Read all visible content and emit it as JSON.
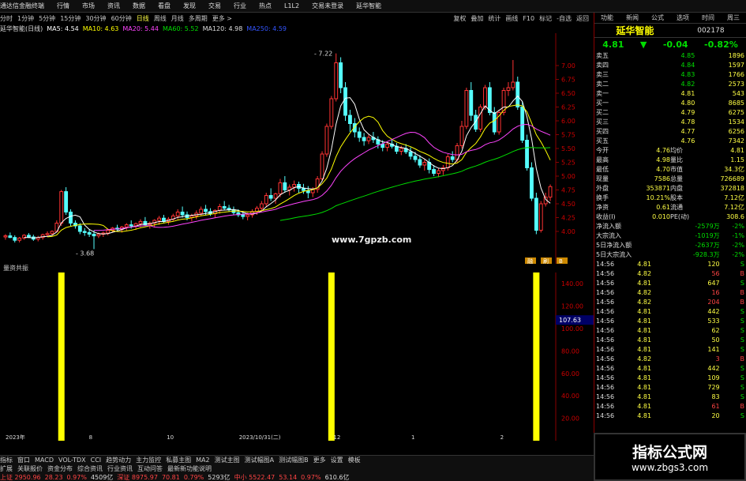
{
  "app": {
    "title": "通达信金融终端",
    "menu": [
      "行情",
      "市场",
      "资讯",
      "数据",
      "看盘",
      "发现",
      "交易",
      "行业",
      "热点",
      "L1L2"
    ],
    "notice": "交易未登录",
    "notice2": "延华智能",
    "right_menu": [
      "功能",
      "新闻",
      "公式",
      "选项",
      "时间",
      "周三",
      "",
      "口",
      "X"
    ]
  },
  "toolbar": {
    "periods": [
      "分时",
      "1分钟",
      "5分钟",
      "15分钟",
      "30分钟",
      "60分钟",
      "日线",
      "周线",
      "月线",
      "多周期",
      "更多 >"
    ],
    "right": [
      "复权",
      "叠加",
      "统计",
      "画线",
      "F10",
      "标记",
      "-自选",
      "返回"
    ]
  },
  "chart_info": {
    "name": "延华智能(日线)",
    "ma": [
      {
        "label": "MA5: 4.54",
        "color": "#ffffff"
      },
      {
        "label": "MA10: 4.63",
        "color": "#ffff00"
      },
      {
        "label": "MA20: 5.44",
        "color": "#ff44ff"
      },
      {
        "label": "MA60: 5.52",
        "color": "#00dd00"
      },
      {
        "label": "MA120: 4.98",
        "color": "#dddddd"
      },
      {
        "label": "MA250: 4.59",
        "color": "#3355ff"
      }
    ]
  },
  "chart_data": {
    "type": "candlestick",
    "ylim": [
      3.5,
      7.5
    ],
    "ticks": [
      "7.00",
      "6.75",
      "6.50",
      "6.25",
      "6.00",
      "5.75",
      "5.50",
      "5.25",
      "5.00",
      "4.75",
      "4.50",
      "4.25",
      "4.00"
    ],
    "candles": [
      [
        3.9,
        3.95,
        3.85,
        3.92
      ],
      [
        3.92,
        3.98,
        3.88,
        3.89
      ],
      [
        3.89,
        3.93,
        3.8,
        3.84
      ],
      [
        3.84,
        3.9,
        3.8,
        3.88
      ],
      [
        3.88,
        3.95,
        3.85,
        3.93
      ],
      [
        3.93,
        3.97,
        3.88,
        3.9
      ],
      [
        3.9,
        3.94,
        3.83,
        3.86
      ],
      [
        3.86,
        3.92,
        3.82,
        3.89
      ],
      [
        3.89,
        3.96,
        3.85,
        3.94
      ],
      [
        3.94,
        4.0,
        3.9,
        3.96
      ],
      [
        3.96,
        4.02,
        3.92,
        4.0
      ],
      [
        4.0,
        4.2,
        3.98,
        4.15
      ],
      [
        4.15,
        4.75,
        4.1,
        4.72
      ],
      [
        4.72,
        4.8,
        4.3,
        4.35
      ],
      [
        4.35,
        4.4,
        4.1,
        4.15
      ],
      [
        4.15,
        4.2,
        4.05,
        4.1
      ],
      [
        4.1,
        4.15,
        3.95,
        4.0
      ],
      [
        4.0,
        4.06,
        3.92,
        3.98
      ],
      [
        3.98,
        4.04,
        3.9,
        3.95
      ],
      [
        3.95,
        4.02,
        3.68,
        3.92
      ],
      [
        3.92,
        3.98,
        3.88,
        3.95
      ],
      [
        3.95,
        4.0,
        3.9,
        3.97
      ],
      [
        3.97,
        4.05,
        3.93,
        4.02
      ],
      [
        4.02,
        4.08,
        3.98,
        4.06
      ],
      [
        4.06,
        4.12,
        4.0,
        4.04
      ],
      [
        4.04,
        4.1,
        3.98,
        4.08
      ],
      [
        4.08,
        4.15,
        4.02,
        4.12
      ],
      [
        4.12,
        4.2,
        4.05,
        4.1
      ],
      [
        4.1,
        4.16,
        4.03,
        4.14
      ],
      [
        4.14,
        4.22,
        4.08,
        4.18
      ],
      [
        4.18,
        4.26,
        4.1,
        4.12
      ],
      [
        4.12,
        4.18,
        4.05,
        4.15
      ],
      [
        4.15,
        4.22,
        4.08,
        4.2
      ],
      [
        4.2,
        4.28,
        4.12,
        4.24
      ],
      [
        4.24,
        4.3,
        4.15,
        4.18
      ],
      [
        4.18,
        4.26,
        4.12,
        4.22
      ],
      [
        4.22,
        4.32,
        4.18,
        4.28
      ],
      [
        4.28,
        4.4,
        4.22,
        4.35
      ],
      [
        4.35,
        4.45,
        4.25,
        4.3
      ],
      [
        4.3,
        4.36,
        4.2,
        4.25
      ],
      [
        4.25,
        4.32,
        4.18,
        4.28
      ],
      [
        4.28,
        4.38,
        4.22,
        4.33
      ],
      [
        4.33,
        4.45,
        4.28,
        4.4
      ],
      [
        4.4,
        4.48,
        4.3,
        4.36
      ],
      [
        4.36,
        4.42,
        4.28,
        4.32
      ],
      [
        4.32,
        4.4,
        4.25,
        4.38
      ],
      [
        4.38,
        4.5,
        4.32,
        4.45
      ],
      [
        4.45,
        4.55,
        4.38,
        4.42
      ],
      [
        4.42,
        4.48,
        4.35,
        4.39
      ],
      [
        4.39,
        4.45,
        4.3,
        4.34
      ],
      [
        4.34,
        4.4,
        4.26,
        4.3
      ],
      [
        4.3,
        4.36,
        4.22,
        4.27
      ],
      [
        4.27,
        4.34,
        4.2,
        4.3
      ],
      [
        4.3,
        4.4,
        4.25,
        4.36
      ],
      [
        4.36,
        4.46,
        4.3,
        4.42
      ],
      [
        4.42,
        4.55,
        4.38,
        4.5
      ],
      [
        4.5,
        4.7,
        4.45,
        4.65
      ],
      [
        4.65,
        4.78,
        4.55,
        4.6
      ],
      [
        4.6,
        4.7,
        4.5,
        4.68
      ],
      [
        4.68,
        4.95,
        4.62,
        4.88
      ],
      [
        4.88,
        5.0,
        4.7,
        4.75
      ],
      [
        4.75,
        4.85,
        4.65,
        4.8
      ],
      [
        4.8,
        4.92,
        4.72,
        4.85
      ],
      [
        4.85,
        4.9,
        4.7,
        4.78
      ],
      [
        4.78,
        4.86,
        4.68,
        4.74
      ],
      [
        4.74,
        4.82,
        4.6,
        4.7
      ],
      [
        4.7,
        4.8,
        4.62,
        4.76
      ],
      [
        4.76,
        5.0,
        4.7,
        4.95
      ],
      [
        4.95,
        5.45,
        4.9,
        5.4
      ],
      [
        5.4,
        5.95,
        5.35,
        5.9
      ],
      [
        5.9,
        6.45,
        5.85,
        6.4
      ],
      [
        6.4,
        7.22,
        6.35,
        7.05
      ],
      [
        7.05,
        7.15,
        6.5,
        6.6
      ],
      [
        6.6,
        6.7,
        6.0,
        6.1
      ],
      [
        6.1,
        6.2,
        5.8,
        5.95
      ],
      [
        5.95,
        6.05,
        5.7,
        5.8
      ],
      [
        5.8,
        5.88,
        5.62,
        5.7
      ],
      [
        5.7,
        5.78,
        5.55,
        5.64
      ],
      [
        5.64,
        5.75,
        5.58,
        5.7
      ],
      [
        5.7,
        5.8,
        5.6,
        5.66
      ],
      [
        5.66,
        5.72,
        5.5,
        5.58
      ],
      [
        5.58,
        5.65,
        5.45,
        5.52
      ],
      [
        5.52,
        5.62,
        5.45,
        5.58
      ],
      [
        5.58,
        5.66,
        5.5,
        5.54
      ],
      [
        5.54,
        5.6,
        5.4,
        5.45
      ],
      [
        5.45,
        5.55,
        5.38,
        5.5
      ],
      [
        5.5,
        5.58,
        5.4,
        5.44
      ],
      [
        5.44,
        5.52,
        5.3,
        5.36
      ],
      [
        5.36,
        5.44,
        5.25,
        5.3
      ],
      [
        5.3,
        5.38,
        5.15,
        5.2
      ],
      [
        5.2,
        5.3,
        5.1,
        5.25
      ],
      [
        5.25,
        5.32,
        5.05,
        5.12
      ],
      [
        5.12,
        5.2,
        5.0,
        5.05
      ],
      [
        5.05,
        5.15,
        4.98,
        5.1
      ],
      [
        5.1,
        5.2,
        5.02,
        5.15
      ],
      [
        5.15,
        5.4,
        5.1,
        5.35
      ],
      [
        5.35,
        5.45,
        5.25,
        5.3
      ],
      [
        5.3,
        5.6,
        5.25,
        5.55
      ],
      [
        5.55,
        6.0,
        5.5,
        5.9
      ],
      [
        5.9,
        6.6,
        5.85,
        6.55
      ],
      [
        6.55,
        6.7,
        6.0,
        6.1
      ],
      [
        6.1,
        6.2,
        5.8,
        5.85
      ],
      [
        5.85,
        6.3,
        5.8,
        6.25
      ],
      [
        6.25,
        6.65,
        6.2,
        6.6
      ],
      [
        6.6,
        6.7,
        6.1,
        6.15
      ],
      [
        6.15,
        6.25,
        5.75,
        5.8
      ],
      [
        5.8,
        6.2,
        5.75,
        6.15
      ],
      [
        6.15,
        6.6,
        6.1,
        6.55
      ],
      [
        6.55,
        6.7,
        6.45,
        6.6
      ],
      [
        6.6,
        7.1,
        6.55,
        6.7
      ],
      [
        6.7,
        6.8,
        6.2,
        6.25
      ],
      [
        6.25,
        6.35,
        5.6,
        5.65
      ],
      [
        5.65,
        5.75,
        5.1,
        5.15
      ],
      [
        5.15,
        5.25,
        4.55,
        4.6
      ],
      [
        4.6,
        4.7,
        3.95,
        4.02
      ],
      [
        4.02,
        4.55,
        3.98,
        4.5
      ],
      [
        4.5,
        4.7,
        4.45,
        4.62
      ],
      [
        4.62,
        4.85,
        4.55,
        4.81
      ]
    ],
    "labels": {
      "high": "7.22",
      "low": "3.68",
      "badges": [
        "融",
        "刷",
        "B"
      ]
    }
  },
  "indicator": {
    "title": "量资共振",
    "ticks": [
      "140.00",
      "120.00",
      "100.00",
      "80.00",
      "60.00",
      "40.00",
      "20.00"
    ],
    "ylim": [
      0,
      150
    ],
    "marker": "107.63",
    "bars": [
      {
        "index": 12,
        "value": 150
      },
      {
        "index": 70,
        "value": 150
      },
      {
        "index": 114,
        "value": 150
      }
    ]
  },
  "date_axis": [
    "2023年",
    "8",
    "10",
    "2023/10/31(二)",
    "12",
    "1",
    "2"
  ],
  "side": {
    "name": "延华智能",
    "code": "002178",
    "price": "4.81",
    "change": "-0.04",
    "pct": "-0.82%",
    "orderbook": [
      {
        "l": "卖五",
        "p": "4.85",
        "v": "1896",
        "c": "#00dd00"
      },
      {
        "l": "卖四",
        "p": "4.84",
        "v": "1597",
        "c": "#00dd00"
      },
      {
        "l": "卖三",
        "p": "4.83",
        "v": "1766",
        "c": "#00dd00"
      },
      {
        "l": "卖二",
        "p": "4.82",
        "v": "2573",
        "c": "#00dd00"
      },
      {
        "l": "卖一",
        "p": "4.81",
        "v": "543",
        "c": "#00dd00"
      },
      {
        "l": "买一",
        "p": "4.80",
        "v": "8685",
        "c": "#00dd00"
      },
      {
        "l": "买二",
        "p": "4.79",
        "v": "6275",
        "c": "#00dd00"
      },
      {
        "l": "买三",
        "p": "4.78",
        "v": "1534",
        "c": "#00dd00"
      },
      {
        "l": "买四",
        "p": "4.77",
        "v": "6256",
        "c": "#00dd00"
      },
      {
        "l": "买五",
        "p": "4.76",
        "v": "7342",
        "c": "#00dd00"
      }
    ],
    "stats": [
      [
        "今开",
        "4.76",
        "均价",
        "4.81"
      ],
      [
        "最高",
        "4.98",
        "量比",
        "1.15"
      ],
      [
        "最低",
        "4.70",
        "市值",
        "34.3亿"
      ],
      [
        "现量",
        "7586",
        "总量",
        "726689"
      ],
      [
        "外盘",
        "353871",
        "内盘",
        "372818"
      ],
      [
        "换手",
        "10.21%",
        "股本",
        "7.12亿"
      ],
      [
        "净资",
        "0.61",
        "流通",
        "7.12亿"
      ],
      [
        "收益(I)",
        "0.010",
        "PE(动)",
        "308.6"
      ]
    ],
    "flows": [
      [
        "净流入额",
        "-2579万",
        "-2%"
      ],
      [
        "大宗流入",
        "-1019万",
        "-1%"
      ],
      [
        "5日净流入额",
        "-2637万",
        "-2%"
      ],
      [
        "5日大宗流入",
        "-928.3万",
        "-2%"
      ]
    ],
    "trades": [
      [
        "14:56",
        "4.81",
        "120",
        "S"
      ],
      [
        "14:56",
        "4.82",
        "56",
        "B"
      ],
      [
        "14:56",
        "4.81",
        "647",
        "S"
      ],
      [
        "14:56",
        "4.82",
        "16",
        "B"
      ],
      [
        "14:56",
        "4.82",
        "204",
        "B"
      ],
      [
        "14:56",
        "4.81",
        "442",
        "S"
      ],
      [
        "14:56",
        "4.81",
        "533",
        "S"
      ],
      [
        "14:56",
        "4.81",
        "62",
        "S"
      ],
      [
        "14:56",
        "4.81",
        "50",
        "S"
      ],
      [
        "14:56",
        "4.81",
        "141",
        "S"
      ],
      [
        "14:56",
        "4.82",
        "3",
        "B"
      ],
      [
        "14:56",
        "4.81",
        "442",
        "S"
      ],
      [
        "14:56",
        "4.81",
        "109",
        "S"
      ],
      [
        "14:56",
        "4.81",
        "729",
        "S"
      ],
      [
        "14:56",
        "4.81",
        "83",
        "S"
      ],
      [
        "14:56",
        "4.81",
        "61",
        "B"
      ],
      [
        "14:56",
        "4.81",
        "20",
        "S"
      ]
    ]
  },
  "bottom": {
    "tabs": [
      "指标",
      "窗口",
      "MACD",
      "VOL-TDX",
      "CCI",
      "趋势动力",
      "主力监控",
      "私募主图",
      "MA2",
      "测试主图",
      "测试幅图A",
      "测试幅图B",
      "更多",
      "设置",
      "模板"
    ],
    "tabs2": [
      "扩展",
      "关联报价",
      "资金分布",
      "综合资讯",
      "行业资讯",
      "互动问答",
      "最新新功能说明"
    ],
    "ticker": [
      [
        "上证",
        "2950.96",
        "#ff4444"
      ],
      [
        "28.23",
        "",
        "#ff4444"
      ],
      [
        "0.97%",
        "",
        "#ff4444"
      ],
      [
        "4509亿",
        "",
        "#ddd"
      ],
      [
        "深证",
        "8975.97",
        "#ff4444"
      ],
      [
        "70.81",
        "",
        "#ff4444"
      ],
      [
        "0.79%",
        "",
        "#ff4444"
      ],
      [
        "5293亿",
        "",
        "#ddd"
      ],
      [
        "中小",
        "5522.47",
        "#ff4444"
      ],
      [
        "53.14",
        "",
        "#ff4444"
      ],
      [
        "0.97%",
        "",
        "#ff4444"
      ],
      [
        "610.6亿",
        "",
        "#ddd"
      ]
    ]
  },
  "watermark": {
    "brand": "指标公式网",
    "url": "www.zbgs3.com",
    "site": "www.7gpzb.com"
  }
}
